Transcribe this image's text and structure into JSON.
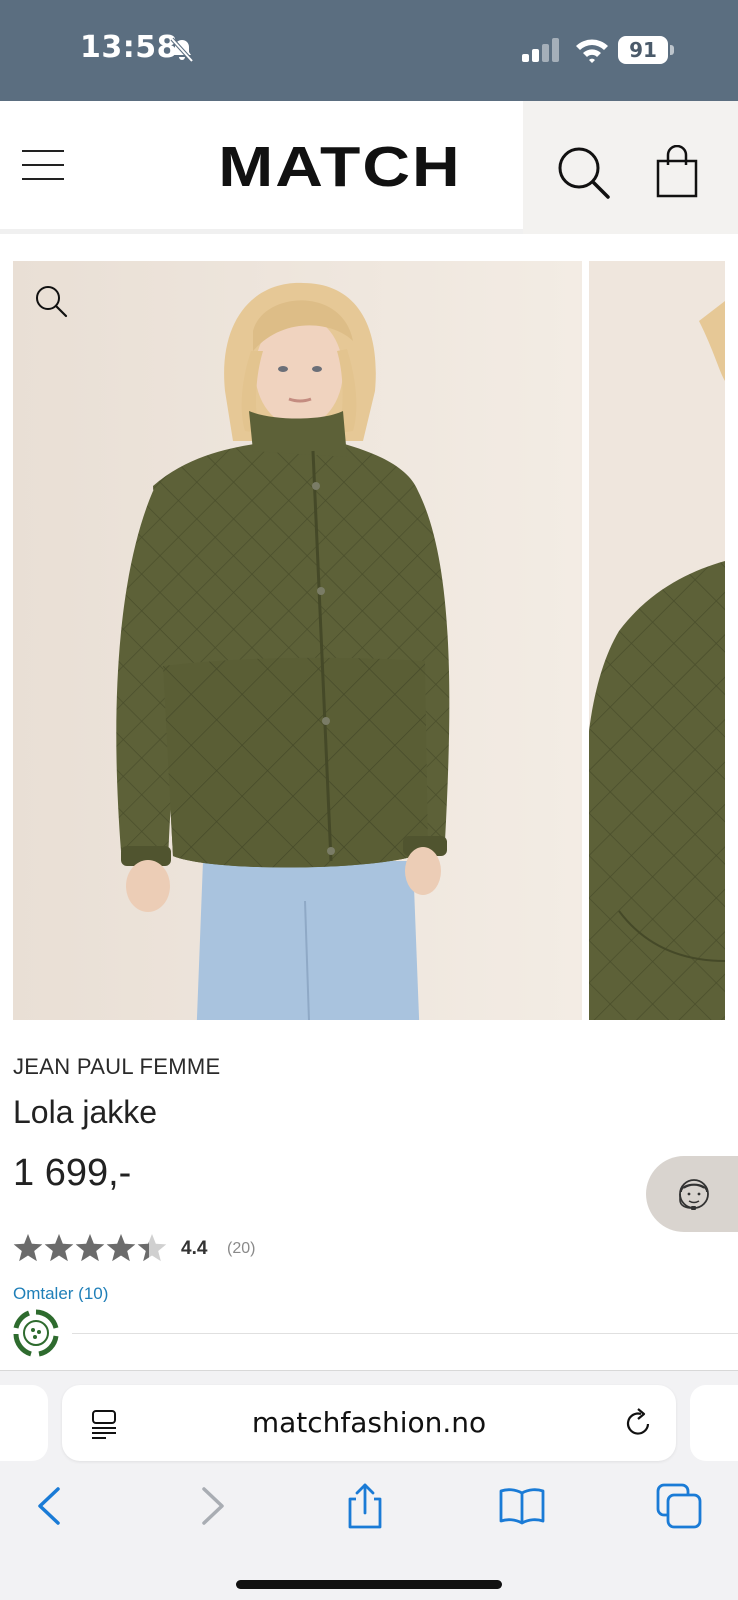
{
  "status_bar": {
    "time": "13:58",
    "battery": "91",
    "icons": [
      "bell-slash-icon",
      "signal-icon",
      "wifi-icon",
      "battery-icon"
    ]
  },
  "header": {
    "logo": "MATCH",
    "icons": [
      "menu-icon",
      "search-icon",
      "bag-icon"
    ]
  },
  "gallery": {
    "zoom_icon": "magnifier-icon",
    "colors": {
      "background": "#efe7df",
      "jacket": "#5d6138",
      "jeans": "#a9c3de",
      "hair": "#e6c896"
    }
  },
  "product": {
    "brand": "JEAN PAUL FEMME",
    "name": "Lola jakke",
    "price": "1 699,-",
    "rating_value": "4.4",
    "rating_count": "(20)",
    "rating_stars": 4.4,
    "reviews_link": "Omtaler (10)"
  },
  "browser": {
    "url": "matchfashion.no",
    "icons": [
      "reader-icon",
      "reload-icon",
      "back-icon",
      "forward-icon",
      "share-icon",
      "bookmarks-icon",
      "tabs-icon"
    ]
  },
  "colors": {
    "status_bar": "#5b6e80",
    "link": "#1f7fb8",
    "star": "#6b6b6b",
    "safari_blue": "#1a7bd6"
  }
}
